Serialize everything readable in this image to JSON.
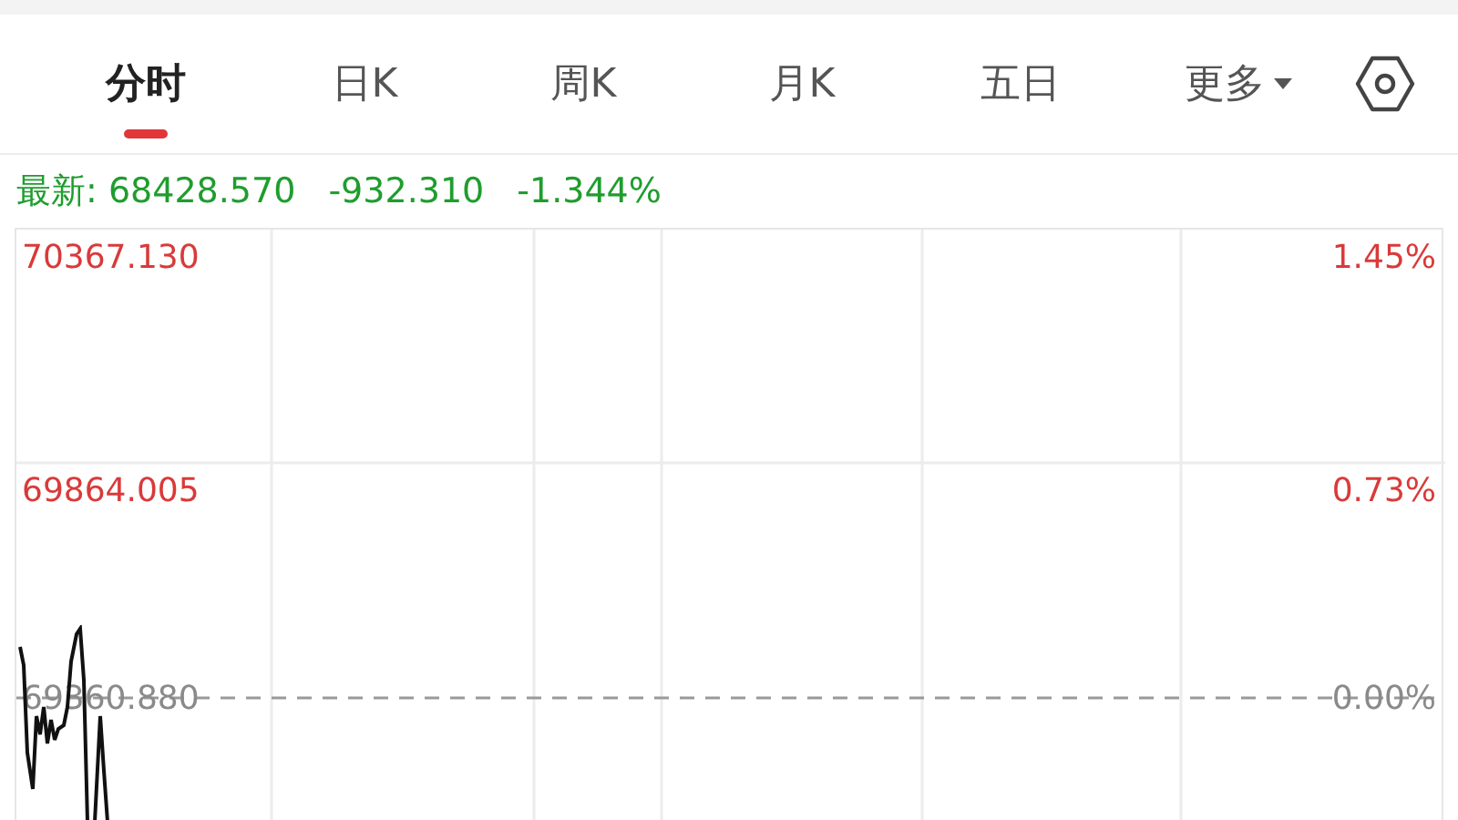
{
  "tabs": [
    {
      "label": "分时",
      "selected": true,
      "kind": "plain"
    },
    {
      "label": "日K",
      "selected": false,
      "kind": "plain"
    },
    {
      "label": "周K",
      "selected": false,
      "kind": "plain"
    },
    {
      "label": "月K",
      "selected": false,
      "kind": "plain"
    },
    {
      "label": "五日",
      "selected": false,
      "kind": "plain"
    },
    {
      "label": "更多",
      "selected": false,
      "kind": "dropdown"
    }
  ],
  "quote": {
    "label": "最新:",
    "price": "68428.570",
    "change": "-932.310",
    "percent": "-1.344%",
    "kind": "down"
  },
  "axis_rows": [
    {
      "price": "70367.130",
      "percent": "1.45%",
      "kind": "up"
    },
    {
      "price": "69864.005",
      "percent": "0.73%",
      "kind": "up"
    },
    {
      "price": "69360.880",
      "percent": "0.00%",
      "kind": "flat"
    }
  ]
}
